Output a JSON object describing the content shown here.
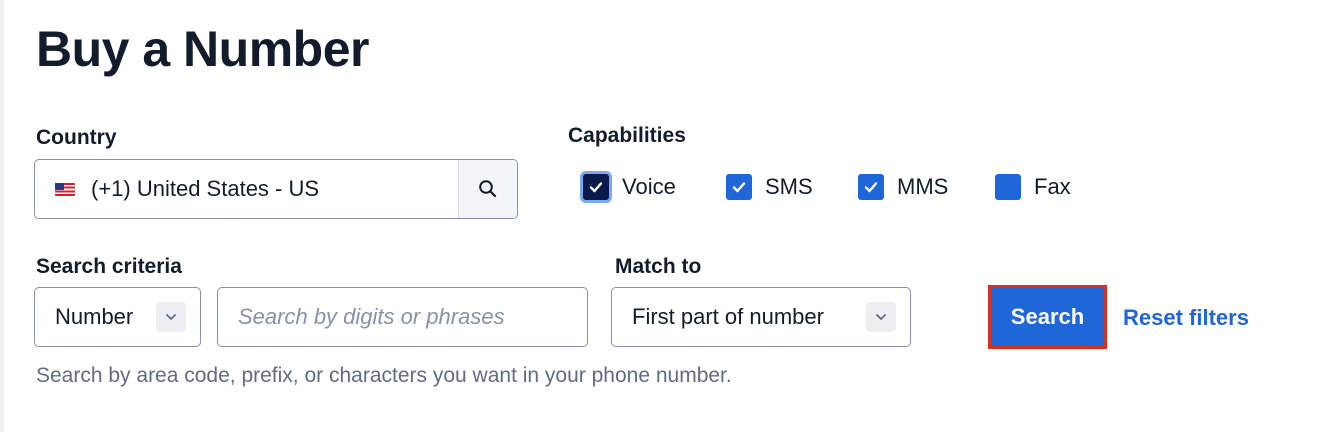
{
  "page": {
    "title": "Buy a Number"
  },
  "country": {
    "label": "Country",
    "flag_icon": "us-flag-icon",
    "value": "(+1) United States - US",
    "search_icon": "search-icon"
  },
  "capabilities": {
    "label": "Capabilities",
    "items": [
      {
        "label": "Voice",
        "checked": true,
        "focused": true
      },
      {
        "label": "SMS",
        "checked": true,
        "focused": false
      },
      {
        "label": "MMS",
        "checked": true,
        "focused": false
      },
      {
        "label": "Fax",
        "checked": false,
        "focused": false
      }
    ]
  },
  "search_criteria": {
    "label": "Search criteria",
    "selected": "Number",
    "placeholder": "Search by digits or phrases",
    "value": ""
  },
  "match_to": {
    "label": "Match to",
    "selected": "First part of number"
  },
  "actions": {
    "search_label": "Search",
    "reset_label": "Reset filters"
  },
  "help_text": "Search by area code, prefix, or characters you want in your phone number.",
  "colors": {
    "primary": "#1f67d8",
    "focus_ring": "#7aa7ee",
    "highlight_border": "#d6301f",
    "text": "#121c2d",
    "muted_text": "#606b85"
  }
}
